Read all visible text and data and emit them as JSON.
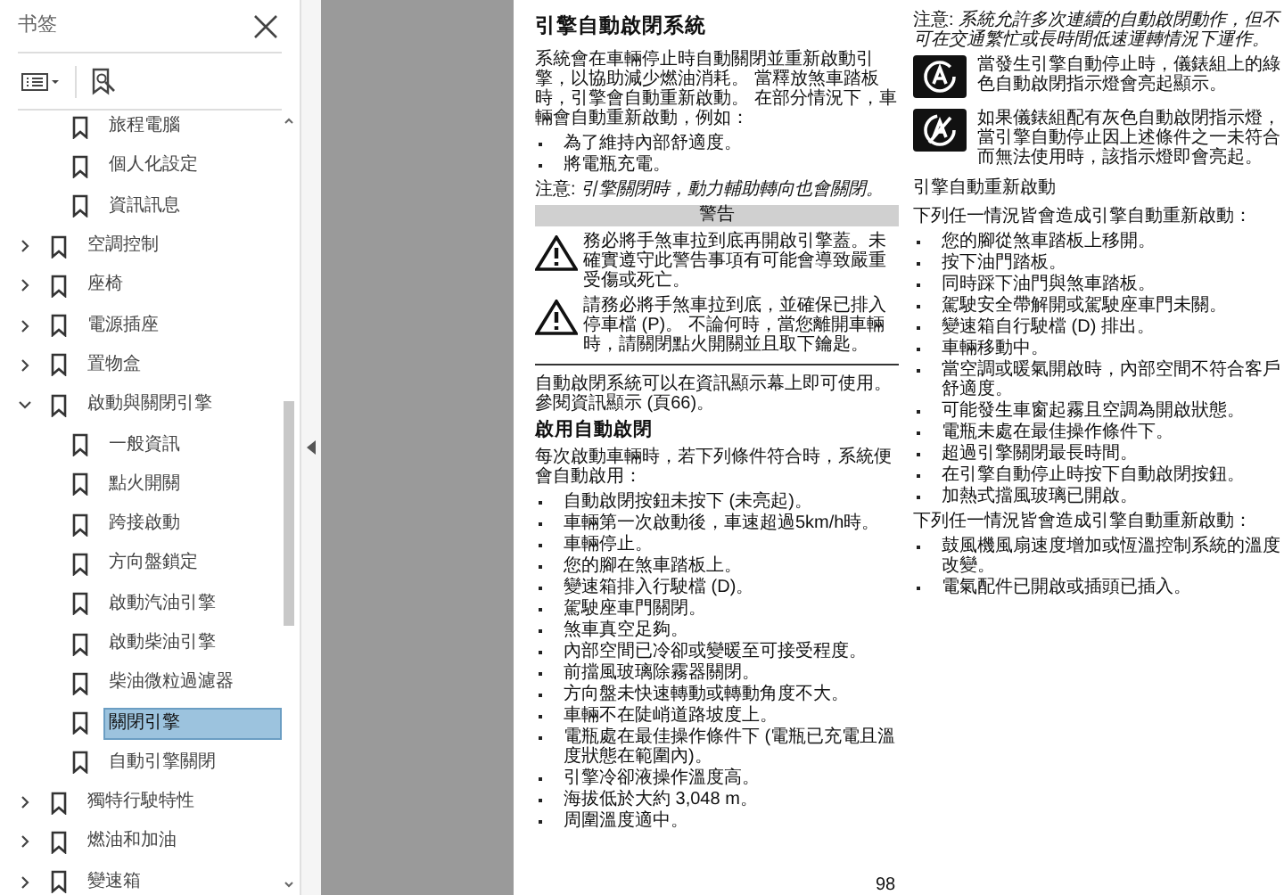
{
  "sidebar": {
    "title": "书签",
    "items": [
      {
        "children": [
          {
            "label": "旅程電腦",
            "selected": false
          },
          {
            "label": "個人化設定",
            "selected": false
          },
          {
            "label": "資訊訊息",
            "selected": false
          }
        ]
      },
      {
        "label": "空調控制",
        "expanded": false,
        "selected": false
      },
      {
        "label": "座椅",
        "expanded": false,
        "selected": false
      },
      {
        "label": "電源插座",
        "expanded": false,
        "selected": false
      },
      {
        "label": "置物盒",
        "expanded": false,
        "selected": false
      },
      {
        "label": "啟動與關閉引擎",
        "expanded": true,
        "selected": false,
        "children": [
          {
            "label": "一般資訊",
            "selected": false
          },
          {
            "label": "點火開關",
            "selected": false
          },
          {
            "label": "跨接啟動",
            "selected": false
          },
          {
            "label": "方向盤鎖定",
            "selected": false
          },
          {
            "label": "啟動汽油引擎",
            "selected": false
          },
          {
            "label": "啟動柴油引擎",
            "selected": false
          },
          {
            "label": "柴油微粒過濾器",
            "selected": false
          },
          {
            "label": "關閉引擎",
            "selected": true
          },
          {
            "label": "自動引擎關閉",
            "selected": false
          }
        ]
      },
      {
        "label": "獨特行駛特性",
        "expanded": false,
        "selected": false
      },
      {
        "label": "燃油和加油",
        "expanded": false,
        "selected": false
      },
      {
        "label": "變速箱",
        "expanded": false,
        "selected": false
      }
    ]
  },
  "page": {
    "columns": [
      [
        {
          "kind": "title",
          "text": "引擎自動啟閉系統"
        },
        {
          "kind": "para",
          "text": "系統會在車輛停止時自動關閉並重新啟動引擎，以協助減少燃油消耗。 當釋放煞車踏板時，引擎會自動重新啟動。 在部分情況下，車輛會自動重新啟動，例如："
        },
        {
          "kind": "bullets",
          "items": [
            "為了維持內部舒適度。",
            "將電瓶充電。"
          ]
        },
        {
          "kind": "note",
          "text": "注意: *引擎關閉時，動力輔助轉向也會關閉。*"
        },
        {
          "kind": "warning",
          "title": "警告",
          "items": [
            "務必將手煞車拉到底再開啟引擎蓋。未確實遵守此警告事項有可能會導致嚴重受傷或死亡。",
            "請務必將手煞車拉到底，並確保已排入停車檔 (P)。 不論何時，當您離開車輛時，請關閉點火開關並且取下鑰匙。"
          ]
        },
        {
          "kind": "para",
          "text": "自動啟閉系統可以在資訊顯示幕上即可使用。參閱資訊顯示 (頁66)。"
        },
        {
          "kind": "heading",
          "text": "啟用自動啟閉"
        },
        {
          "kind": "para",
          "text": "每次啟動車輛時，若下列條件符合時，系統便會自動啟用："
        },
        {
          "kind": "bullets",
          "items": [
            "自動啟閉按鈕未按下 (未亮起)。",
            "車輛第一次啟動後，車速超過5km/h時。",
            "車輛停止。",
            "您的腳在煞車踏板上。",
            "變速箱排入行駛檔 (D)。",
            "駕駛座車門關閉。",
            "煞車真空足夠。",
            "內部空間已冷卻或變暖至可接受程度。",
            "前擋風玻璃除霧器關閉。",
            "方向盤未快速轉動或轉動角度不大。",
            "車輛不在陡峭道路坡度上。",
            "電瓶處在最佳操作條件下 (電瓶已充電且溫度狀態在範圍內)。",
            "引擎冷卻液操作溫度高。",
            "海拔低於大約 3,048 m。",
            "周圍溫度適中。"
          ]
        }
      ],
      [
        {
          "kind": "note",
          "text": "注意: *系統允許多次連續的自動啟閉動作，但不可在交通繁忙或長時間低速運轉情況下運作。*"
        },
        {
          "kind": "indicators",
          "items": [
            "當發生引擎自動停止時，儀錶組上的綠色自動啟閉指示燈會亮起顯示。",
            "如果儀錶組配有灰色自動啟閉指示燈，當引擎自動停止因上述條件之一未符合而無法使用時，該指示燈即會亮起。"
          ]
        },
        {
          "kind": "subheading",
          "text": "引擎自動重新啟動"
        },
        {
          "kind": "para",
          "text": "下列任一情況皆會造成引擎自動重新啟動："
        },
        {
          "kind": "bullets",
          "items": [
            "您的腳從煞車踏板上移開。",
            "按下油門踏板。",
            "同時踩下油門與煞車踏板。",
            "駕駛安全帶解開或駕駛座車門未關。",
            "變速箱自行駛檔 (D) 排出。",
            "車輛移動中。",
            "當空調或暖氣開啟時，內部空間不符合客戶舒適度。",
            "可能發生車窗起霧且空調為開啟狀態。",
            "電瓶未處在最佳操作條件下。",
            "超過引擎關閉最長時間。",
            "在引擎自動停止時按下自動啟閉按鈕。",
            "加熱式擋風玻璃已開啟。"
          ]
        },
        {
          "kind": "para",
          "text": "下列任一情況皆會造成引擎自動重新啟動："
        },
        {
          "kind": "bullets",
          "items": [
            "鼓風機風扇速度增加或恆溫控制系統的溫度改變。",
            "電氣配件已開啟或插頭已插入。"
          ]
        }
      ]
    ],
    "page_number": "98"
  }
}
